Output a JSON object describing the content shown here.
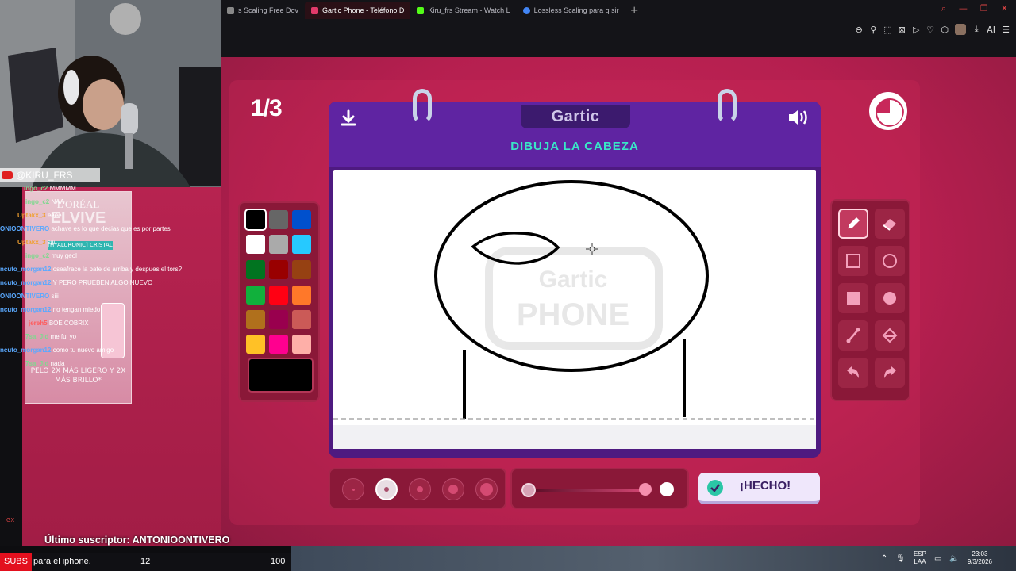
{
  "browser": {
    "tabs": [
      {
        "label": "s Scaling Free Dov",
        "fav_color": "#888888",
        "active": false
      },
      {
        "label": "Gartic Phone - Teléfono D",
        "fav_color": "#e23a6a",
        "active": true
      },
      {
        "label": "Kiru_frs Stream - Watch L",
        "fav_color": "#53fc18",
        "active": false
      },
      {
        "label": "Lossless Scaling para q sir",
        "fav_color": "#4285f4",
        "active": false
      }
    ],
    "new_tab": "+",
    "toolbar_ai": "AI"
  },
  "game": {
    "round": "1/3",
    "notebook_title": "Gartic",
    "instruction": "DIBUJA LA CABEZA",
    "watermark_line1": "Gartic",
    "watermark_line2": "PHONE",
    "done_label": "¡HECHO!",
    "selected_color": "#000000",
    "palette": [
      "#000000",
      "#666666",
      "#0050cd",
      "#ffffff",
      "#aaaaaa",
      "#26c9ff",
      "#017420",
      "#990000",
      "#964112",
      "#11b03c",
      "#ff0013",
      "#ff7829",
      "#b0701c",
      "#99004e",
      "#cb5a57",
      "#ffc126",
      "#ff008f",
      "#feafa8"
    ],
    "tools": [
      "pencil-icon",
      "eraser-icon",
      "rectangle-outline-icon",
      "circle-outline-icon",
      "rectangle-fill-icon",
      "circle-fill-icon",
      "line-icon",
      "bucket-icon",
      "undo-icon",
      "redo-icon"
    ],
    "brush_sizes_selected": 2,
    "opacity": 1.0
  },
  "stream": {
    "cam_handle": "@KIRU_FRS",
    "chat": [
      {
        "user": "ingo_c2",
        "msg": "MMMMM",
        "color": "#7fd88f"
      },
      {
        "user": "ingo_c2",
        "msg": "NAA",
        "color": "#7fd88f"
      },
      {
        "user": "Uptakx_3",
        "msg": "eeee",
        "color": "#f0a030"
      },
      {
        "user": "ONIOONTIVERO",
        "msg": "achave es lo que decias que es por partes",
        "color": "#5aa9ff"
      },
      {
        "user": "Uptakx_3",
        "msg": "siii",
        "color": "#f0a030"
      },
      {
        "user": "ingo_c2",
        "msg": "muy geol",
        "color": "#7fd88f"
      },
      {
        "user": "ncuto_morgan12",
        "msg": "oseafrace la pate de arriba y despues el tors?",
        "color": "#5aa9ff"
      },
      {
        "user": "ncuto_morgan12",
        "msg": "Y PERO PRUEBEN ALGO NUEVO",
        "color": "#5aa9ff"
      },
      {
        "user": "ONIOONTIVERO",
        "msg": "siii",
        "color": "#5aa9ff"
      },
      {
        "user": "ncuto_morgan12",
        "msg": "no tengan miedo",
        "color": "#5aa9ff"
      },
      {
        "user": "jereh5",
        "msg": "BOE COBRIX",
        "color": "#ff5a5a"
      },
      {
        "user": "7sa_Jid",
        "msg": "me fui yo",
        "color": "#7fd88f"
      },
      {
        "user": "ncuto_morgan12",
        "msg": "como tu nuevo amigo",
        "color": "#5aa9ff"
      },
      {
        "user": "7sa_Jid",
        "msg": "nada",
        "color": "#7fd88f"
      }
    ],
    "ad": {
      "brand": "L'ORÉAL",
      "product": "ELVIVE",
      "subtitle": "[HYALURONIC] CRISTAL",
      "tagline": "PELO 2X MÁS LIGERO Y 2X MÁS BRILLO*"
    },
    "last_sub": "Último suscriptor: ANTONIOONTIVERO",
    "gx": "GX",
    "ticker": {
      "subs_label": "SUBS",
      "text": "para el iphone.",
      "current": "12",
      "goal": "100"
    }
  },
  "taskbar": {
    "lang_line1": "ESP",
    "lang_line2": "LAA",
    "time": "23:03",
    "date": "9/3/2026"
  }
}
